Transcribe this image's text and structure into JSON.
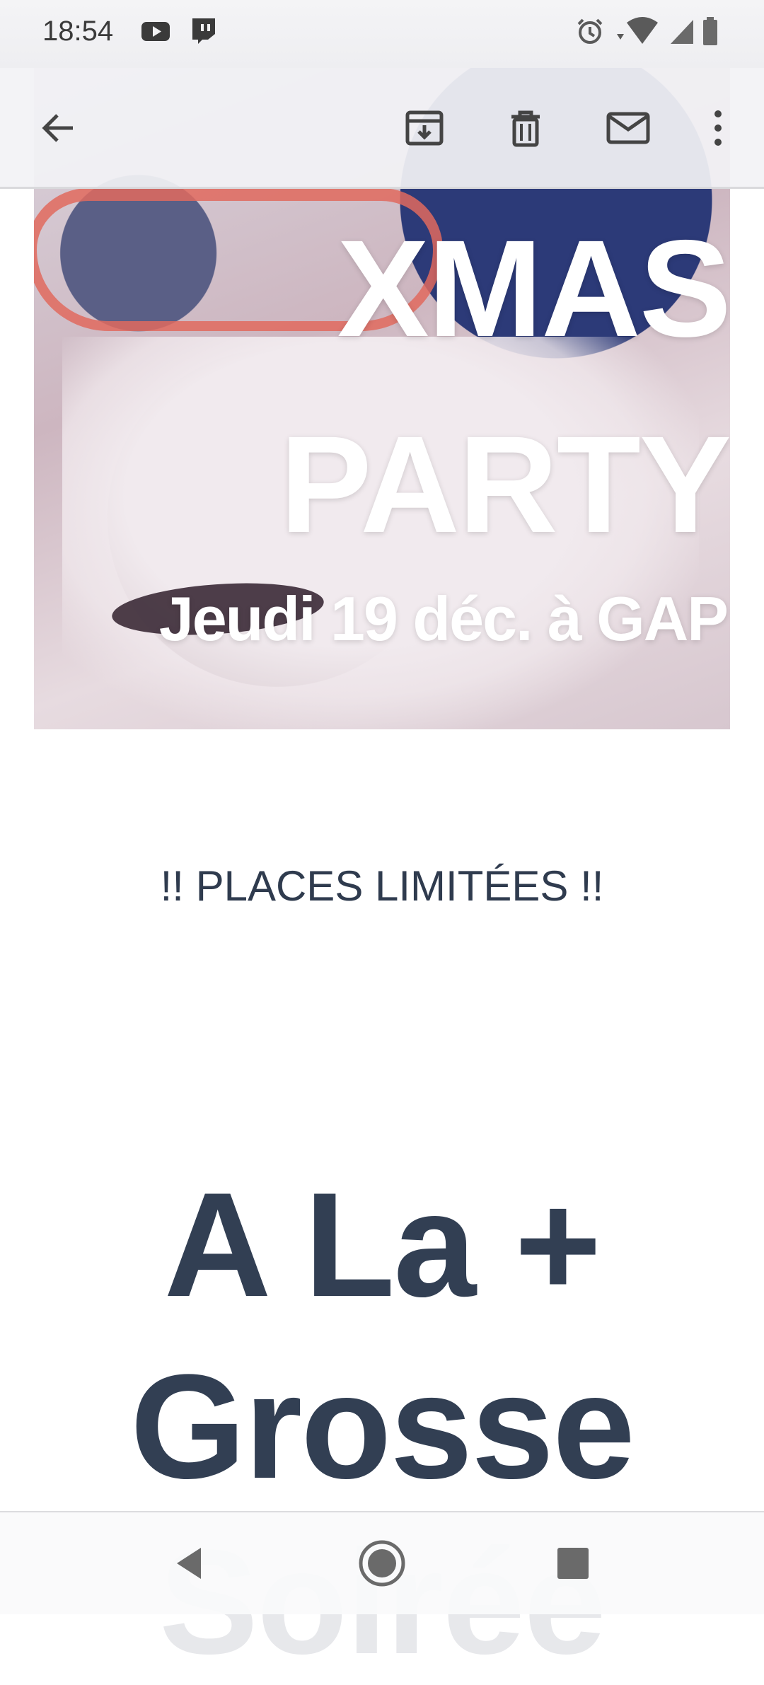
{
  "status_bar": {
    "time": "18:54",
    "left_icons": [
      "youtube-icon",
      "twitch-icon"
    ],
    "right_icons": [
      "alarm-icon",
      "wifi-icon",
      "signal-icon",
      "battery-icon"
    ]
  },
  "toolbar": {
    "actions": [
      "back-arrow-icon",
      "archive-icon",
      "delete-icon",
      "mark-unread-icon",
      "more-options-icon"
    ]
  },
  "email": {
    "hero": {
      "line1": "XMAS",
      "line2": "PARTY",
      "line3": "Jeudi 19 déc. à GAP"
    },
    "notice": "!! PLACES LIMITÉES !!",
    "headline": {
      "line1": "A La +",
      "line2": "Grosse",
      "line3": "Soirée"
    }
  },
  "nav_bar": {
    "buttons": [
      "nav-back-icon",
      "nav-home-icon",
      "nav-recents-icon"
    ]
  },
  "colors": {
    "text_dark": "#323f53",
    "hero_text": "#ffffff",
    "bar_background": "#f2f2f5"
  }
}
